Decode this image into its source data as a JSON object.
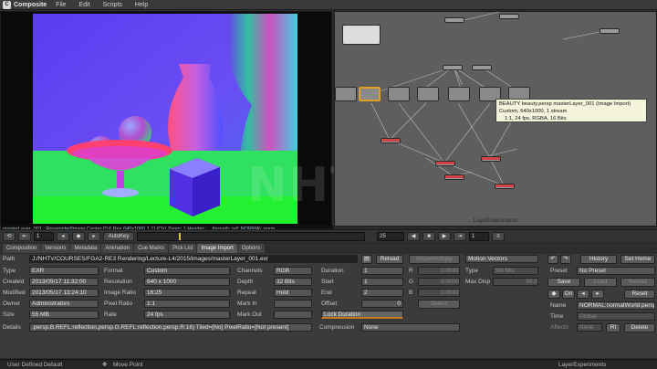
{
  "menubar": {
    "app_name": "Composite",
    "items": [
      "File",
      "Edit",
      "Scripts",
      "Help"
    ]
  },
  "viewer": {
    "status_text": "masterLayer_001 : ResampledImage Center [0.6 Res 640x1000 1 1] (Ch) Zoom: 1 Header: ... through: ref: NORMAL:norm",
    "watermark": "NHTV"
  },
  "nodegraph": {
    "title": "LayerExperiments",
    "tooltip_line1": "BEAUTY beauty.persp masterLayer_001 (Image Import)",
    "tooltip_line2": "Custom, 640x1000, 1 stream",
    "tooltip_line3": "1:1, 24 fps, RGBA, 16 Bits"
  },
  "timeline": {
    "frame_field": "1",
    "autokey_label": "AutoKey",
    "current_frame": "25",
    "end_field": "1"
  },
  "tabs": [
    "Composition",
    "Versions",
    "Metadata",
    "Animation",
    "Cue Marks",
    "Pick List",
    "Image Import",
    "Options"
  ],
  "props": {
    "path_label": "Path",
    "path_value": "J:/NHTV/COURSES/FGA2-RE3 Rendering/Lecture-L4/2015/images/masterLayer_001.exr",
    "reload_label": "Reload",
    "unpremultiply_label": "Unpremultiply",
    "motion_vectors_label": "Motion Vectors",
    "type_label": "Type",
    "type_value": "EXR",
    "format_label": "Format",
    "format_value": "Custom",
    "channels_label": "Channels",
    "channels_value": "RGB",
    "duration_label": "Duration",
    "duration_value": "1",
    "created_label": "Created",
    "created_value": "2013/05/17 11:32:00",
    "resolution_label": "Resolution",
    "resolution_value": "640 x 1000",
    "depth_label": "Depth",
    "depth_value": "32 Bits",
    "start_label": "Start",
    "start_value": "1",
    "modified_label": "Modified",
    "modified_value": "2013/05/17 13:24:10",
    "image_ratio_label": "Image Ratio",
    "image_ratio_value": "16:25",
    "repeat_label": "Repeat",
    "repeat_value": "Hold",
    "end_label": "End",
    "end_value": "2",
    "owner_label": "Owner",
    "owner_value": "Administrators",
    "pixel_ratio_label": "Pixel Ratio",
    "pixel_ratio_value": "1:1",
    "mark_in_label": "Mark In",
    "offset_label": "Offset",
    "offset_value": "0",
    "size_label": "Size",
    "size_value": "55 MB",
    "rate_label": "Rate",
    "rate_value": "24 fps",
    "mark_out_label": "Mark Out",
    "lock_duration_label": "Lock Duration",
    "details_label": "Details",
    "details_value": ".persp.B.REFL:reflection.persp.G.REFL:reflection.persp.R:16) Tiled=[No] PixelRatio=[Not present]",
    "compression_label": "Compression",
    "compression_value": "None",
    "r_label": "R",
    "g_label": "G",
    "b_label": "B",
    "r_value": "0.0000",
    "g_value": "0.0000",
    "b_value": "0.0000",
    "select_label": "Select",
    "mv_type_label": "Type",
    "mv_type_value": "5th Mix",
    "max_disp_label": "Max Disp",
    "max_disp_value": "50.0",
    "history_label": "History",
    "set_home_label": "Set Home",
    "preset_label": "Preset",
    "preset_value": "No Preset",
    "save_label": "Save",
    "load_label": "Load",
    "reload2_label": "Reload",
    "on_label": "On",
    "reset_label": "Reset",
    "name_label": "Name",
    "name_value": "NORMAL:normalWorld.persp",
    "time_label": "Time",
    "time_value": "Global",
    "affects_label": "Affects",
    "affects_value": "None",
    "ri_label": "RI",
    "delete_label": "Delete"
  },
  "statusbar": {
    "left": "User Defined Default",
    "tool": "Move Point",
    "right": "LayerExperiments"
  }
}
